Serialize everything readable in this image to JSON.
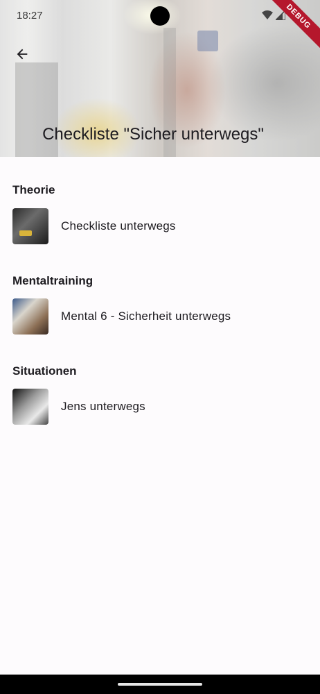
{
  "status_bar": {
    "time": "18:27",
    "debug_label": "DEBUG"
  },
  "header": {
    "title": "Checkliste \"Sicher unterwegs\""
  },
  "sections": [
    {
      "title": "Theorie",
      "items": [
        {
          "label": "Checkliste unterwegs",
          "thumb": "parking-garage-photo"
        }
      ]
    },
    {
      "title": "Mentaltraining",
      "items": [
        {
          "label": "Mental 6 - Sicherheit unterwegs",
          "thumb": "person-photo"
        }
      ]
    },
    {
      "title": "Situationen",
      "items": [
        {
          "label": "Jens unterwegs",
          "thumb": "comic-illustration"
        }
      ]
    }
  ],
  "icons": {
    "back": "arrow-left-icon",
    "wifi": "wifi-icon",
    "signal": "signal-icon"
  }
}
